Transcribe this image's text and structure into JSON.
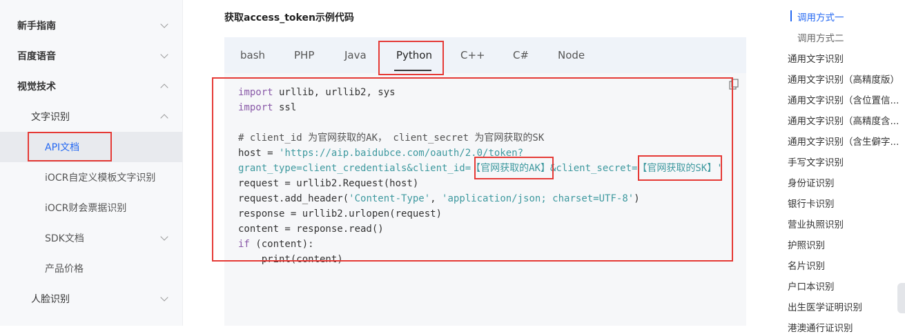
{
  "sidebar": {
    "items": [
      {
        "label": "新手指南",
        "level": 1,
        "chevron": "down"
      },
      {
        "label": "百度语音",
        "level": 1,
        "chevron": "down"
      },
      {
        "label": "视觉技术",
        "level": 1,
        "chevron": "up"
      },
      {
        "label": "文字识别",
        "level": 2,
        "chevron": "up"
      },
      {
        "label": "API文档",
        "level": 3,
        "active": true
      },
      {
        "label": "iOCR自定义模板文字识别",
        "level": 3
      },
      {
        "label": "iOCR财会票据识别",
        "level": 3
      },
      {
        "label": "SDK文档",
        "level": 3,
        "chevron": "down"
      },
      {
        "label": "产品价格",
        "level": 3
      },
      {
        "label": "人脸识别",
        "level": 2,
        "chevron": "down"
      }
    ]
  },
  "main": {
    "title": "获取access_token示例代码",
    "tabs": [
      {
        "label": "bash"
      },
      {
        "label": "PHP"
      },
      {
        "label": "Java"
      },
      {
        "label": "Python",
        "active": true
      },
      {
        "label": "C++"
      },
      {
        "label": "C#"
      },
      {
        "label": "Node"
      }
    ],
    "code": [
      [
        {
          "t": "import",
          "c": "kw"
        },
        {
          "t": " urllib, urllib2, sys",
          "c": ""
        }
      ],
      [
        {
          "t": "import",
          "c": "kw"
        },
        {
          "t": " ssl",
          "c": ""
        }
      ],
      [],
      [
        {
          "t": "# client_id 为官网获取的AK， client_secret 为官网获取的SK",
          "c": "cm"
        }
      ],
      [
        {
          "t": "host = ",
          "c": ""
        },
        {
          "t": "'https://aip.baidubce.com/oauth/2.0/token?",
          "c": "str"
        }
      ],
      [
        {
          "t": "grant_type=client_credentials&client_id=【官网获取的AK】&client_secret=【官网获取的SK】'",
          "c": "str"
        }
      ],
      [
        {
          "t": "request = urllib2.Request(host)",
          "c": ""
        }
      ],
      [
        {
          "t": "request.add_header(",
          "c": ""
        },
        {
          "t": "'Content-Type'",
          "c": "str"
        },
        {
          "t": ", ",
          "c": ""
        },
        {
          "t": "'application/json; charset=UTF-8'",
          "c": "str"
        },
        {
          "t": ")",
          "c": ""
        }
      ],
      [
        {
          "t": "response = urllib2.urlopen(request)",
          "c": ""
        }
      ],
      [
        {
          "t": "content = response.read()",
          "c": ""
        }
      ],
      [
        {
          "t": "if",
          "c": "kw"
        },
        {
          "t": " (content):",
          "c": ""
        }
      ],
      [
        {
          "t": "    print(content)",
          "c": ""
        }
      ]
    ],
    "colors": {
      "keyword": "#8959a8",
      "string": "#3e999f",
      "accent": "#2468f2",
      "highlight": "#e53935"
    }
  },
  "toc": {
    "items": [
      {
        "label": "调用方式一",
        "sub": true,
        "active": true
      },
      {
        "label": "调用方式二",
        "sub": true
      },
      {
        "label": "通用文字识别"
      },
      {
        "label": "通用文字识别（高精度版）"
      },
      {
        "label": "通用文字识别（含位置信..."
      },
      {
        "label": "通用文字识别（高精度含..."
      },
      {
        "label": "通用文字识别（含生僻字..."
      },
      {
        "label": "手写文字识别"
      },
      {
        "label": "身份证识别"
      },
      {
        "label": "银行卡识别"
      },
      {
        "label": "营业执照识别"
      },
      {
        "label": "护照识别"
      },
      {
        "label": "名片识别"
      },
      {
        "label": "户口本识别"
      },
      {
        "label": "出生医学证明识别"
      },
      {
        "label": "港澳通行证识别"
      }
    ]
  }
}
